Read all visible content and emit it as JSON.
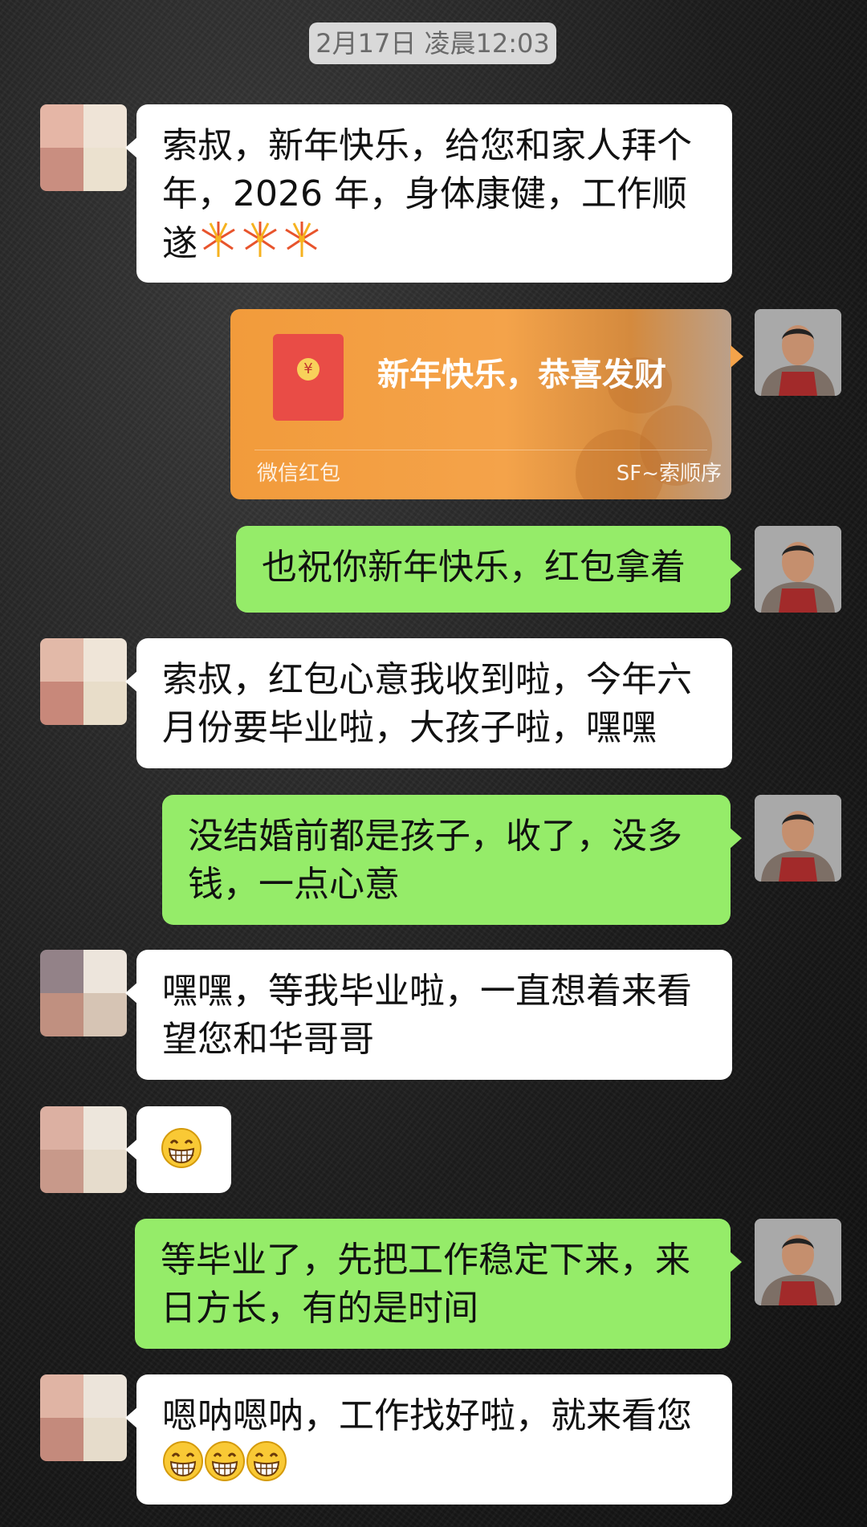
{
  "timestamp": "2月17日 凌晨12:03",
  "colors": {
    "incoming_bubble": "#ffffff",
    "outgoing_bubble": "#95ec69",
    "red_packet": "#f4a34a"
  },
  "messages": [
    {
      "side": "left",
      "text": "索叔，新年快乐，给您和家人拜个年，2026 年，身体康健，工作顺遂",
      "emoji": [
        "fireworks-icon",
        "fireworks-icon",
        "fireworks-icon"
      ]
    },
    {
      "side": "right",
      "type": "red_packet",
      "title": "新年快乐，恭喜发财",
      "footer_left": "微信红包",
      "footer_right": "SF~索顺序"
    },
    {
      "side": "right",
      "text": "也祝你新年快乐，红包拿着"
    },
    {
      "side": "left",
      "text": "索叔，红包心意我收到啦，今年六月份要毕业啦，大孩子啦，嘿嘿"
    },
    {
      "side": "right",
      "text": "没结婚前都是孩子，收了，没多钱，一点心意"
    },
    {
      "side": "left",
      "text": "嘿嘿，等我毕业啦，一直想着来看望您和华哥哥"
    },
    {
      "side": "left",
      "emoji": [
        "grin-icon"
      ]
    },
    {
      "side": "right",
      "text": "等毕业了，先把工作稳定下来，来日方长，有的是时间"
    },
    {
      "side": "left",
      "text": "嗯呐嗯呐，工作找好啦，就来看您",
      "emoji": [
        "grin-icon",
        "grin-icon",
        "grin-icon"
      ]
    }
  ],
  "line_breaks": {
    "m0": [
      "索叔，新年快乐，给您和家人拜个",
      "年，2026 年，身体康健，工作顺",
      "遂"
    ],
    "m3": [
      "索叔，红包心意我收到啦，今年六",
      "月份要毕业啦，大孩子啦，嘿嘿"
    ],
    "m4": [
      "没结婚前都是孩子，收了，没多",
      "钱，一点心意"
    ],
    "m5": [
      "嘿嘿，等我毕业啦，一直想着来看",
      "望您和华哥哥"
    ],
    "m7": [
      "等毕业了，先把工作稳定下来，来",
      "日方长，有的是时间"
    ],
    "m8": [
      "嗯呐嗯呐，工作找好啦，就来看您"
    ]
  }
}
